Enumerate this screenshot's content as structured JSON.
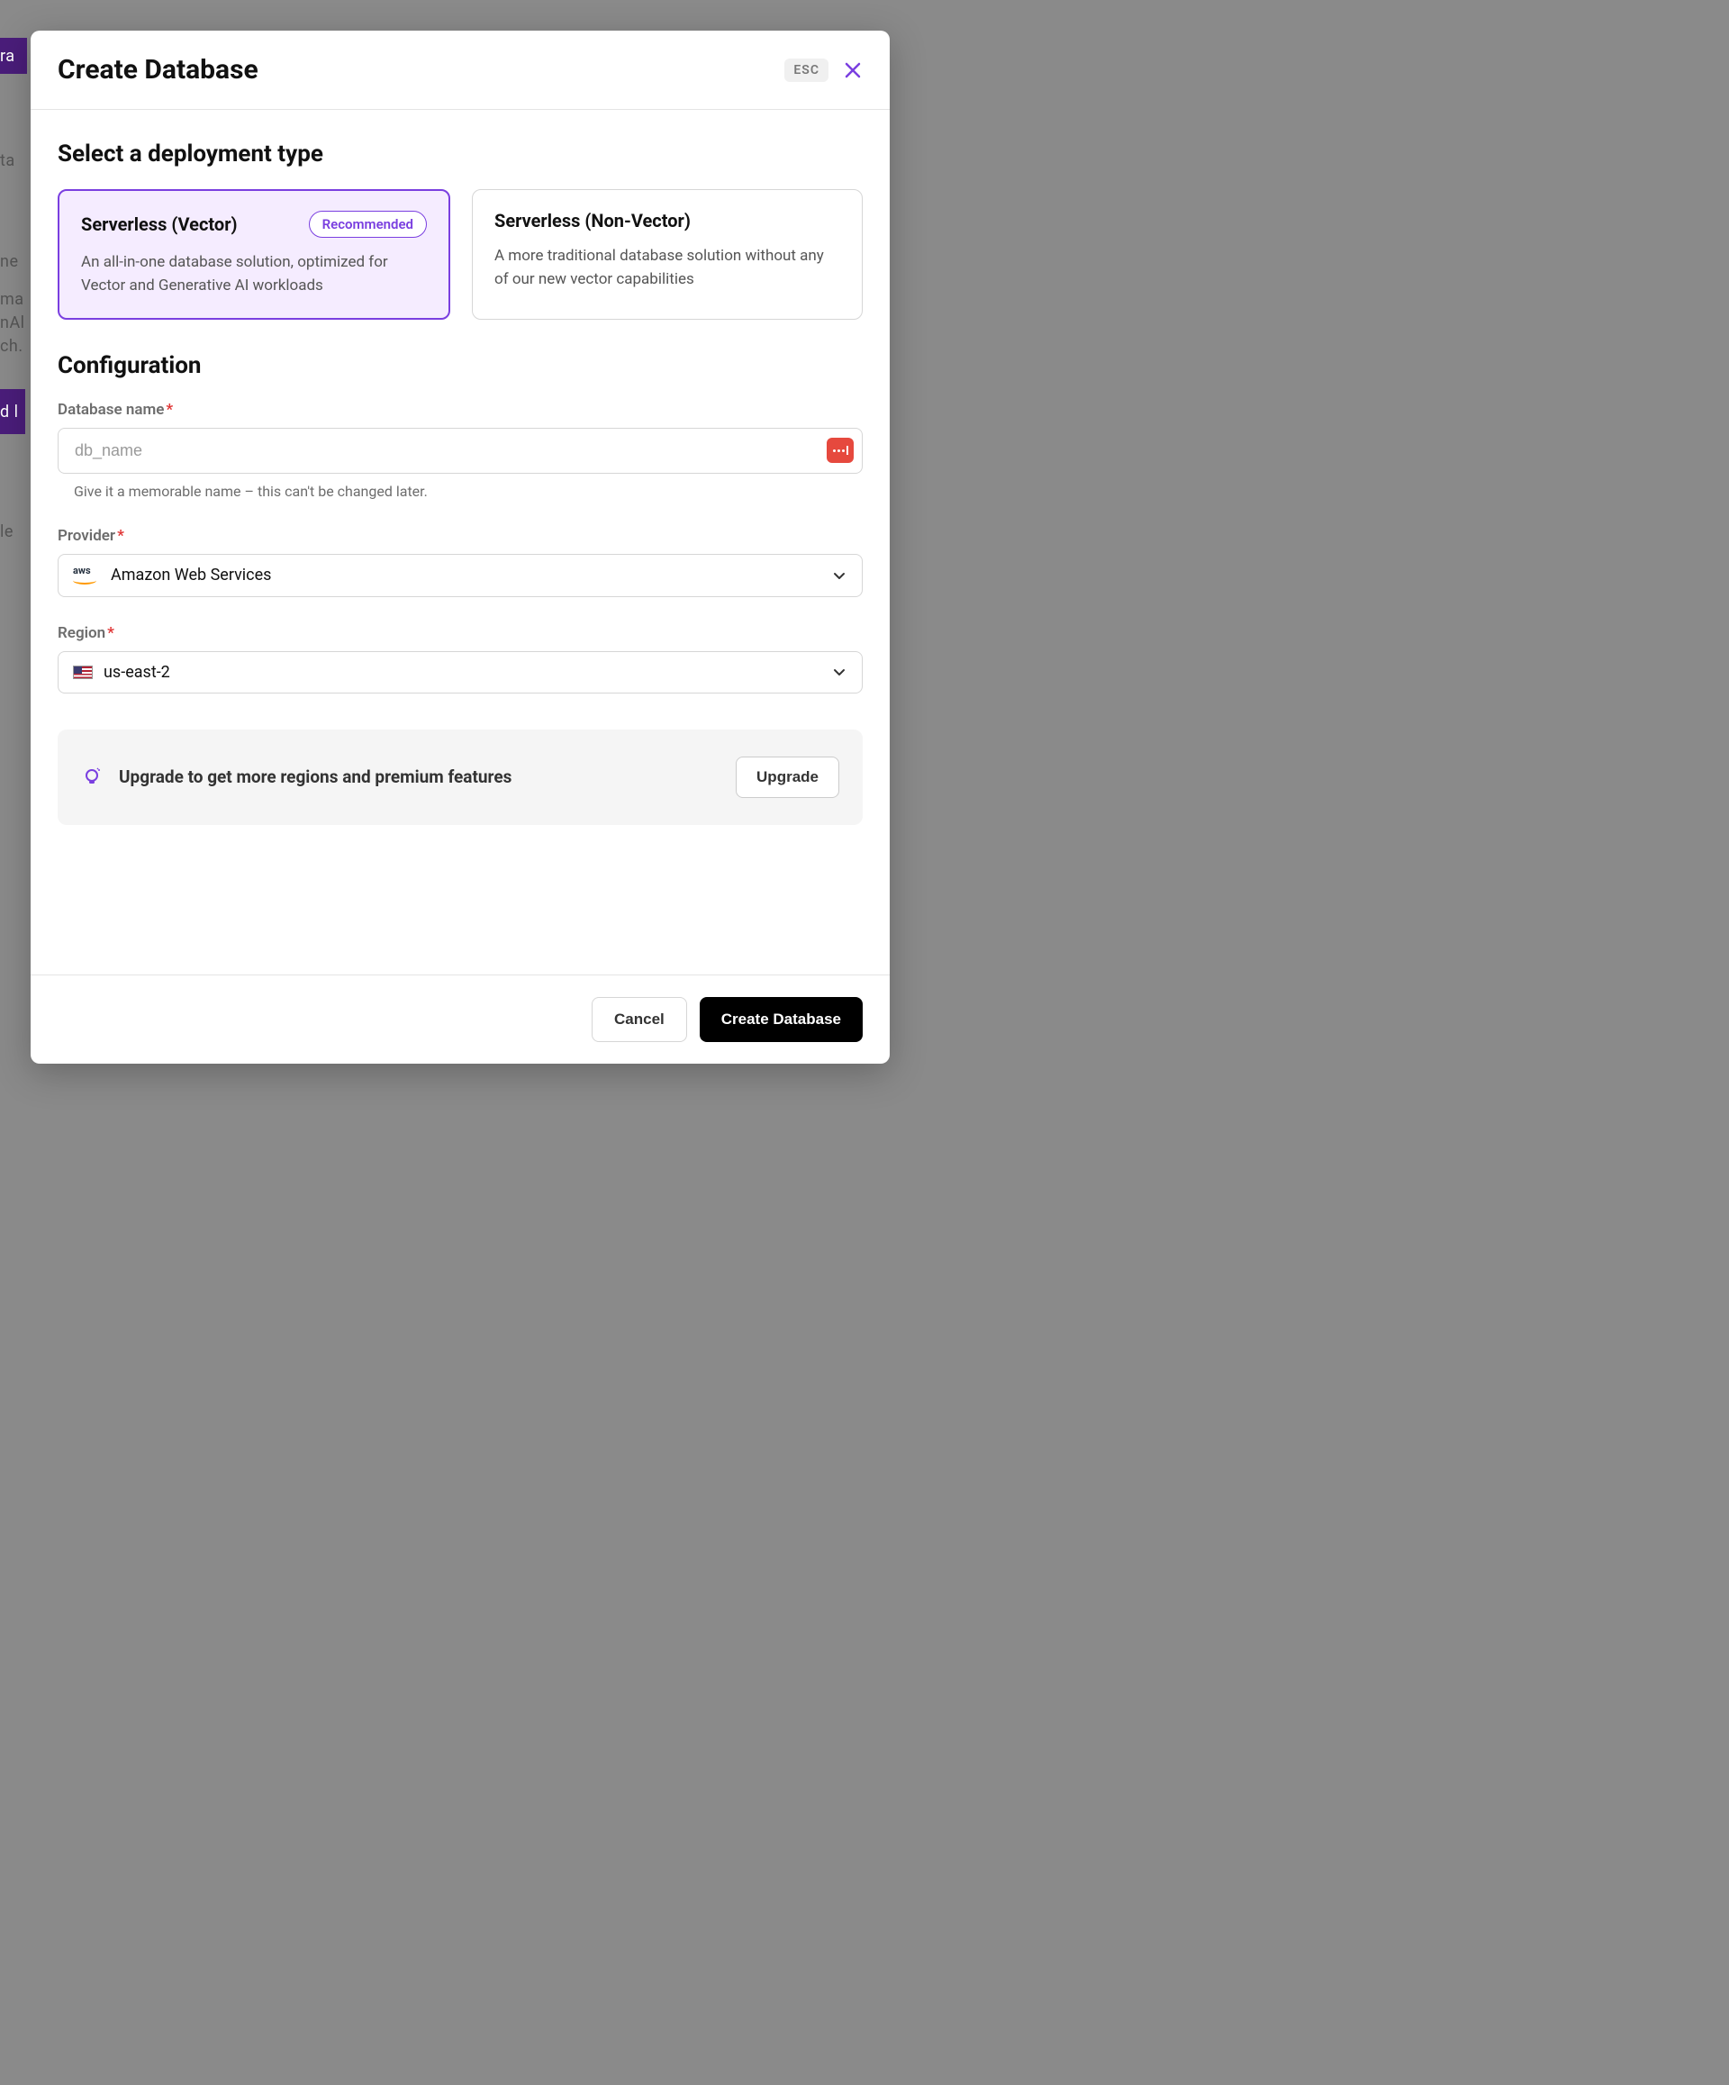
{
  "modal": {
    "title": "Create Database",
    "esc_label": "ESC"
  },
  "deployment": {
    "section_title": "Select a deployment type",
    "options": [
      {
        "title": "Serverless (Vector)",
        "badge": "Recommended",
        "description": "An all-in-one database solution, optimized for Vector and Generative AI workloads"
      },
      {
        "title": "Serverless (Non-Vector)",
        "description": "A more traditional database solution without any of our new vector capabilities"
      }
    ]
  },
  "config": {
    "section_title": "Configuration",
    "db_name": {
      "label": "Database name",
      "placeholder": "db_name",
      "value": "",
      "helper": "Give it a memorable name – this can't be changed later."
    },
    "provider": {
      "label": "Provider",
      "selected": "Amazon Web Services"
    },
    "region": {
      "label": "Region",
      "selected": "us-east-2"
    }
  },
  "upgrade": {
    "text": "Upgrade to get more regions and premium features",
    "button": "Upgrade"
  },
  "footer": {
    "cancel": "Cancel",
    "create": "Create Database"
  },
  "required_mark": "*"
}
